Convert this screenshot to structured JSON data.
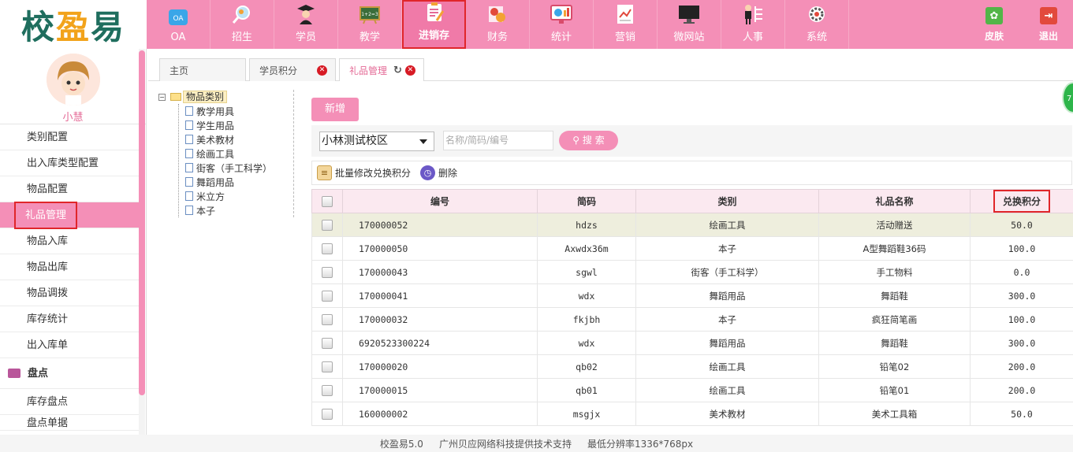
{
  "app": {
    "logo_text": [
      "校",
      "盈",
      "易"
    ],
    "accent": "#f48fb7",
    "highlight_red": "#e0262a"
  },
  "nav": {
    "items": [
      {
        "label": "OA",
        "icon": "oa-icon"
      },
      {
        "label": "招生",
        "icon": "magnifier-icon"
      },
      {
        "label": "学员",
        "icon": "graduate-icon"
      },
      {
        "label": "教学",
        "icon": "blackboard-icon"
      },
      {
        "label": "进销存",
        "icon": "clipboard-icon"
      },
      {
        "label": "财务",
        "icon": "coins-icon"
      },
      {
        "label": "统计",
        "icon": "monitor-chart-icon"
      },
      {
        "label": "营销",
        "icon": "trend-doc-icon"
      },
      {
        "label": "微网站",
        "icon": "desktop-icon"
      },
      {
        "label": "人事",
        "icon": "person-icon"
      },
      {
        "label": "系统",
        "icon": "gear-icon"
      }
    ],
    "active_index": 4,
    "skin_label": "皮肤",
    "logout_label": "退出"
  },
  "user": {
    "name": "小慧"
  },
  "sidebar": {
    "items": [
      {
        "label": "类别配置"
      },
      {
        "label": "出入库类型配置"
      },
      {
        "label": "物品配置"
      },
      {
        "label": "礼品管理"
      },
      {
        "label": "物品入库"
      },
      {
        "label": "物品出库"
      },
      {
        "label": "物品调拨"
      },
      {
        "label": "库存统计"
      },
      {
        "label": "出入库单"
      }
    ],
    "group_label": "盘点",
    "group_items": [
      {
        "label": "库存盘点"
      },
      {
        "label": "盘点单据"
      }
    ]
  },
  "tabs": [
    {
      "label": "主页"
    },
    {
      "label": "学员积分"
    },
    {
      "label": "礼品管理"
    }
  ],
  "tree": {
    "root": "物品类别",
    "children": [
      "教学用具",
      "学生用品",
      "美术教材",
      "绘画工具",
      "街客（手工科学）",
      "舞蹈用品",
      "米立方",
      "本子"
    ]
  },
  "actions": {
    "add_label": "新增",
    "campus": "小林测试校区",
    "search_placeholder": "名称/简码/编号",
    "search_label": "搜 索",
    "batch_label": "批量修改兑换积分",
    "delete_label": "删除"
  },
  "table": {
    "columns": [
      "编号",
      "简码",
      "类别",
      "礼品名称",
      "兑换积分"
    ],
    "rows": [
      [
        "170000052",
        "hdzs",
        "绘画工具",
        "活动赠送",
        "50.0"
      ],
      [
        "170000050",
        "Axwdx36m",
        "本子",
        "A型舞蹈鞋36码",
        "100.0"
      ],
      [
        "170000043",
        "sgwl",
        "街客（手工科学）",
        "手工物料",
        "0.0"
      ],
      [
        "170000041",
        "wdx",
        "舞蹈用品",
        "舞蹈鞋",
        "300.0"
      ],
      [
        "170000032",
        "fkjbh",
        "本子",
        "疯狂简笔画",
        "100.0"
      ],
      [
        "6920523300224",
        "wdx",
        "舞蹈用品",
        "舞蹈鞋",
        "300.0"
      ],
      [
        "170000020",
        "qb02",
        "绘画工具",
        "铅笔02",
        "200.0"
      ],
      [
        "170000015",
        "qb01",
        "绘画工具",
        "铅笔01",
        "200.0"
      ],
      [
        "160000002",
        "msgjx",
        "美术教材",
        "美术工具箱",
        "50.0"
      ]
    ]
  },
  "footer": {
    "version": "校盈易5.0",
    "support": "广州贝应网络科技提供技术支持",
    "resolution": "最低分辨率1336*768px"
  }
}
